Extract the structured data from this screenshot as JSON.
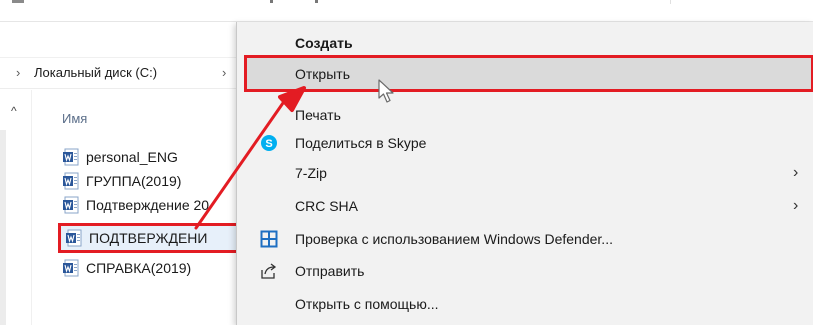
{
  "address_bar": {
    "chevron_left": "›",
    "path": "Локальный диск (C:)",
    "chevron_right": "›"
  },
  "file_list": {
    "column_header": "Имя",
    "files": [
      {
        "name": "personal_ENG",
        "icon": "word-doc-icon"
      },
      {
        "name": "ГРУППА(2019)",
        "icon": "word-doc-icon"
      },
      {
        "name": "Подтверждение 20",
        "icon": "word-doc-icon"
      },
      {
        "name": "ПОДТВЕРЖДЕНИ",
        "icon": "word-doc-icon",
        "selected": true
      },
      {
        "name": "СПРАВКА(2019)",
        "icon": "word-doc-icon"
      }
    ]
  },
  "context_menu": {
    "items": [
      {
        "label": "Создать",
        "bold": true
      },
      {
        "label": "Открыть",
        "highlighted": true
      },
      {
        "label": "Печать"
      },
      {
        "label": "Поделиться в Skype",
        "icon": "skype-icon"
      },
      {
        "label": "7-Zip",
        "submenu": true
      },
      {
        "label": "CRC SHA",
        "submenu": true
      },
      {
        "label": "Проверка с использованием Windows Defender...",
        "icon": "windows-defender-icon"
      },
      {
        "label": "Отправить",
        "icon": "share-icon"
      },
      {
        "label": "Открыть с помощью..."
      }
    ],
    "submenu_arrow": "›"
  },
  "colors": {
    "annotation_red": "#e31c23",
    "menu_background": "#f2f2f2",
    "menu_hover": "#dadada",
    "selection_blue": "#e7f0fa",
    "skype_blue": "#00aff0",
    "defender_blue": "#1e6fc2",
    "word_blue": "#2b579a"
  }
}
